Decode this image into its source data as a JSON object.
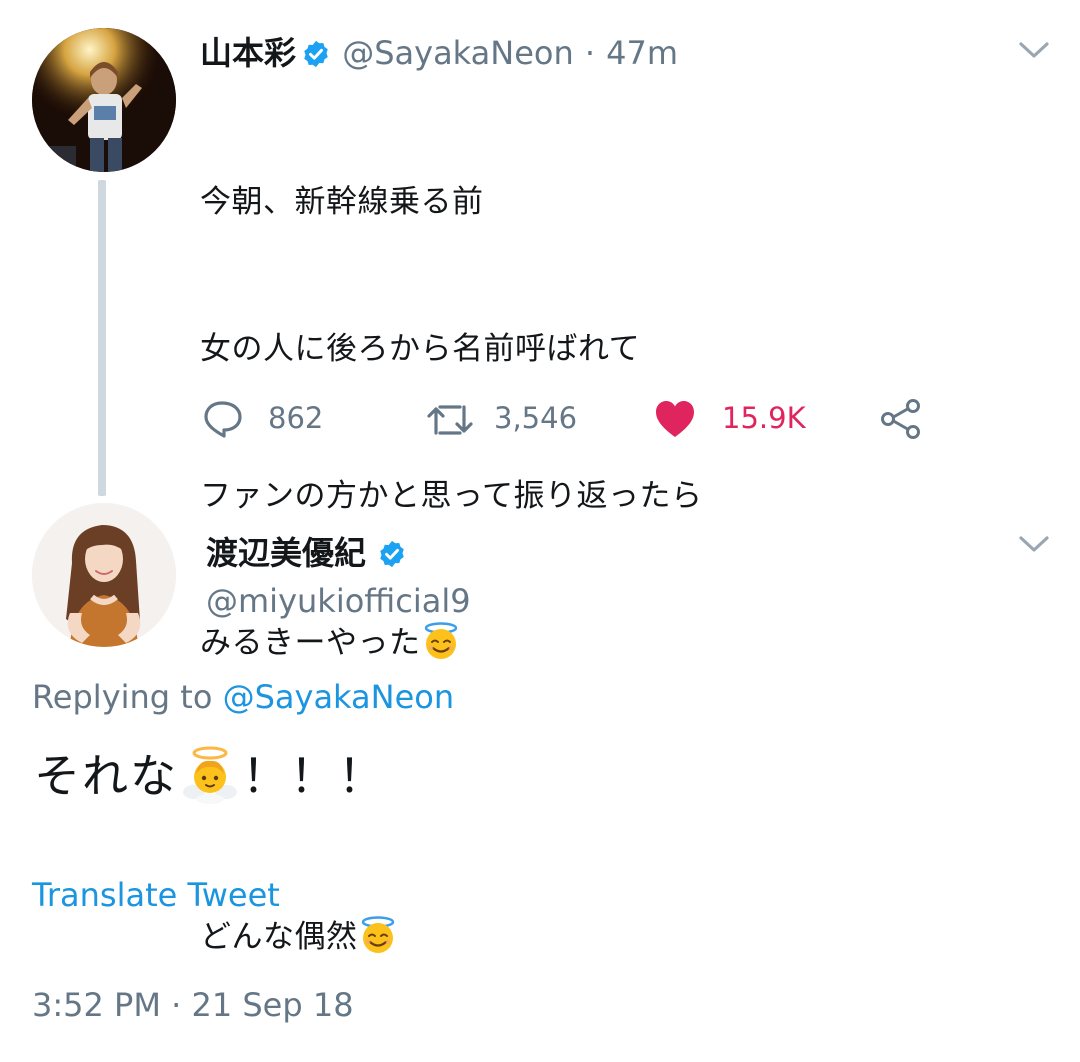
{
  "tweet1": {
    "display_name": "山本彩",
    "handle": "@SayakaNeon",
    "separator": "·",
    "time": "47m",
    "lines": [
      "今朝、新幹線乗る前",
      "女の人に後ろから名前呼ばれて",
      "ファンの方かと思って振り返ったら",
      "みるきーやった",
      "",
      "どんな偶然"
    ],
    "line_emojis": [
      "",
      "",
      "",
      "smiling-face-with-halo",
      "",
      "smiling-face-with-halo"
    ],
    "replies_count": "862",
    "retweets_count": "3,546",
    "likes_count": "15.9K",
    "liked": true
  },
  "tweet2": {
    "display_name": "渡辺美優紀",
    "handle": "@miyukiofficial9",
    "replying_prefix": "Replying to",
    "replying_to": "@SayakaNeon",
    "text_before_emoji": "それな",
    "emoji": "baby-angel",
    "text_after_emoji": "！！！",
    "translate_label": "Translate Tweet",
    "timestamp": "3:52 PM · 21 Sep 18"
  },
  "icons": {
    "verified": "verified-badge-icon",
    "more": "chevron-down-icon",
    "reply": "reply-icon",
    "retweet": "retweet-icon",
    "like": "heart-icon",
    "share": "share-icon"
  },
  "colors": {
    "text": "#14171a",
    "secondary": "#657786",
    "link": "#1b95e0",
    "verified": "#1da1f2",
    "like": "#e0245e",
    "thread_line": "#cfd8df"
  }
}
